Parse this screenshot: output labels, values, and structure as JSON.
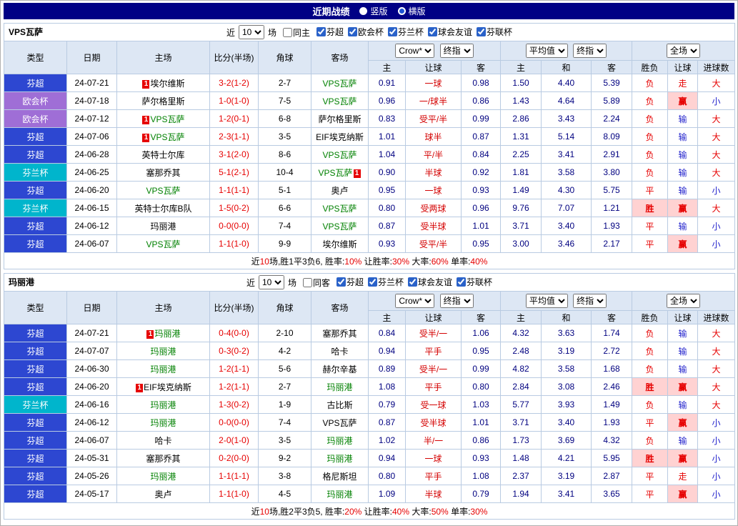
{
  "topbar": {
    "title": "近期战绩",
    "options": [
      {
        "label": "竖版",
        "selected": false
      },
      {
        "label": "横版",
        "selected": true
      }
    ]
  },
  "colors": {
    "topbar_bg": "#000085",
    "league_chao": "#2d47d1",
    "league_euro": "#9f6ed6",
    "league_cup": "#00b5cc",
    "score_red": "#e60000",
    "odds_navy": "#000080",
    "focus_team_green": "#008000",
    "lose_blue": "#2222cc",
    "win_bg": "#ffd2d2",
    "header_bg": "#dde7f4"
  },
  "columns": {
    "main": [
      "类型",
      "日期",
      "主场",
      "比分(半场)",
      "角球",
      "客场"
    ],
    "selects": [
      "Crow*",
      "终指",
      "平均值",
      "终指",
      "全场"
    ],
    "sub": [
      "主",
      "让球",
      "客",
      "主",
      "和",
      "客",
      "胜负",
      "让球",
      "进球数"
    ]
  },
  "sections": [
    {
      "team": "VPS瓦萨",
      "filter": {
        "near": "近",
        "count": "10",
        "games": "场",
        "same": "同主",
        "same_checked": false,
        "leagues": [
          {
            "label": "芬超",
            "checked": true
          },
          {
            "label": "欧会杯",
            "checked": true
          },
          {
            "label": "芬兰杯",
            "checked": true
          },
          {
            "label": "球会友谊",
            "checked": true
          },
          {
            "label": "芬联杯",
            "checked": true
          }
        ]
      },
      "rows": [
        {
          "lg": "芬超",
          "lgc": "blue",
          "date": "24-07-21",
          "home": {
            "n": "埃尔维斯",
            "g": false,
            "b": "1",
            "bs": "L"
          },
          "score": "3-2(1-2)",
          "corner": "2-7",
          "away": {
            "n": "VPS瓦萨",
            "g": true
          },
          "o": [
            "0.91",
            "一球",
            "0.98"
          ],
          "avg": [
            "1.50",
            "4.40",
            "5.39"
          ],
          "res": [
            {
              "t": "负",
              "s": "r"
            },
            {
              "t": "走",
              "s": "r"
            },
            {
              "t": "大",
              "s": "r"
            }
          ]
        },
        {
          "lg": "欧会杯",
          "lgc": "purple",
          "date": "24-07-18",
          "home": {
            "n": "萨尔格里斯",
            "g": false
          },
          "score": "1-0(1-0)",
          "corner": "7-5",
          "away": {
            "n": "VPS瓦萨",
            "g": true
          },
          "o": [
            "0.96",
            "一/球半",
            "0.86"
          ],
          "avg": [
            "1.43",
            "4.64",
            "5.89"
          ],
          "res": [
            {
              "t": "负",
              "s": "r"
            },
            {
              "t": "赢",
              "s": "w"
            },
            {
              "t": "小",
              "s": "b"
            }
          ]
        },
        {
          "lg": "欧会杯",
          "lgc": "purple",
          "date": "24-07-12",
          "home": {
            "n": "VPS瓦萨",
            "g": true,
            "b": "1",
            "bs": "L"
          },
          "score": "1-2(0-1)",
          "corner": "6-8",
          "away": {
            "n": "萨尔格里斯",
            "g": false
          },
          "o": [
            "0.83",
            "受平/半",
            "0.99"
          ],
          "avg": [
            "2.86",
            "3.43",
            "2.24"
          ],
          "res": [
            {
              "t": "负",
              "s": "r"
            },
            {
              "t": "输",
              "s": "b"
            },
            {
              "t": "大",
              "s": "r"
            }
          ]
        },
        {
          "lg": "芬超",
          "lgc": "blue",
          "date": "24-07-06",
          "home": {
            "n": "VPS瓦萨",
            "g": true,
            "b": "1",
            "bs": "L"
          },
          "score": "2-3(1-1)",
          "corner": "3-5",
          "away": {
            "n": "EIF埃克纳斯",
            "g": false
          },
          "o": [
            "1.01",
            "球半",
            "0.87"
          ],
          "avg": [
            "1.31",
            "5.14",
            "8.09"
          ],
          "res": [
            {
              "t": "负",
              "s": "r"
            },
            {
              "t": "输",
              "s": "b"
            },
            {
              "t": "大",
              "s": "r"
            }
          ]
        },
        {
          "lg": "芬超",
          "lgc": "blue",
          "date": "24-06-28",
          "home": {
            "n": "英特士尔库",
            "g": false
          },
          "score": "3-1(2-0)",
          "corner": "8-6",
          "away": {
            "n": "VPS瓦萨",
            "g": true
          },
          "o": [
            "1.04",
            "平/半",
            "0.84"
          ],
          "avg": [
            "2.25",
            "3.41",
            "2.91"
          ],
          "res": [
            {
              "t": "负",
              "s": "r"
            },
            {
              "t": "输",
              "s": "b"
            },
            {
              "t": "大",
              "s": "r"
            }
          ]
        },
        {
          "lg": "芬兰杯",
          "lgc": "cyan",
          "date": "24-06-25",
          "home": {
            "n": "塞那乔其",
            "g": false
          },
          "score": "5-1(2-1)",
          "corner": "10-4",
          "away": {
            "n": "VPS瓦萨",
            "g": true,
            "b": "1",
            "bs": "R"
          },
          "o": [
            "0.90",
            "半球",
            "0.92"
          ],
          "avg": [
            "1.81",
            "3.58",
            "3.80"
          ],
          "res": [
            {
              "t": "负",
              "s": "r"
            },
            {
              "t": "输",
              "s": "b"
            },
            {
              "t": "大",
              "s": "r"
            }
          ]
        },
        {
          "lg": "芬超",
          "lgc": "blue",
          "date": "24-06-20",
          "home": {
            "n": "VPS瓦萨",
            "g": true
          },
          "score": "1-1(1-1)",
          "corner": "5-1",
          "away": {
            "n": "奥卢",
            "g": false
          },
          "o": [
            "0.95",
            "一球",
            "0.93"
          ],
          "avg": [
            "1.49",
            "4.30",
            "5.75"
          ],
          "res": [
            {
              "t": "平",
              "s": "r"
            },
            {
              "t": "输",
              "s": "b"
            },
            {
              "t": "小",
              "s": "b"
            }
          ]
        },
        {
          "lg": "芬兰杯",
          "lgc": "cyan",
          "date": "24-06-15",
          "home": {
            "n": "英特士尔库B队",
            "g": false
          },
          "score": "1-5(0-2)",
          "corner": "6-6",
          "away": {
            "n": "VPS瓦萨",
            "g": true
          },
          "o": [
            "0.80",
            "受两球",
            "0.96"
          ],
          "avg": [
            "9.76",
            "7.07",
            "1.21"
          ],
          "res": [
            {
              "t": "胜",
              "s": "w"
            },
            {
              "t": "赢",
              "s": "w"
            },
            {
              "t": "大",
              "s": "r"
            }
          ]
        },
        {
          "lg": "芬超",
          "lgc": "blue",
          "date": "24-06-12",
          "home": {
            "n": "玛丽港",
            "g": false
          },
          "score": "0-0(0-0)",
          "corner": "7-4",
          "away": {
            "n": "VPS瓦萨",
            "g": true
          },
          "o": [
            "0.87",
            "受半球",
            "1.01"
          ],
          "avg": [
            "3.71",
            "3.40",
            "1.93"
          ],
          "res": [
            {
              "t": "平",
              "s": "r"
            },
            {
              "t": "输",
              "s": "b"
            },
            {
              "t": "小",
              "s": "b"
            }
          ]
        },
        {
          "lg": "芬超",
          "lgc": "blue",
          "date": "24-06-07",
          "home": {
            "n": "VPS瓦萨",
            "g": true
          },
          "score": "1-1(1-0)",
          "corner": "9-9",
          "away": {
            "n": "埃尔维斯",
            "g": false
          },
          "o": [
            "0.93",
            "受平/半",
            "0.95"
          ],
          "avg": [
            "3.00",
            "3.46",
            "2.17"
          ],
          "res": [
            {
              "t": "平",
              "s": "r"
            },
            {
              "t": "赢",
              "s": "w"
            },
            {
              "t": "小",
              "s": "b"
            }
          ]
        }
      ],
      "summary": [
        {
          "t": "近",
          "r": false
        },
        {
          "t": "10",
          "r": true
        },
        {
          "t": "场,胜1平3负6, 胜率:",
          "r": false
        },
        {
          "t": "10%",
          "r": true
        },
        {
          "t": " 让胜率:",
          "r": false
        },
        {
          "t": "30%",
          "r": true
        },
        {
          "t": " 大率:",
          "r": false
        },
        {
          "t": "60%",
          "r": true
        },
        {
          "t": " 单率:",
          "r": false
        },
        {
          "t": "40%",
          "r": true
        }
      ]
    },
    {
      "team": "玛丽港",
      "filter": {
        "near": "近",
        "count": "10",
        "games": "场",
        "same": "同客",
        "same_checked": false,
        "leagues": [
          {
            "label": "芬超",
            "checked": true
          },
          {
            "label": "芬兰杯",
            "checked": true
          },
          {
            "label": "球会友谊",
            "checked": true
          },
          {
            "label": "芬联杯",
            "checked": true
          }
        ]
      },
      "rows": [
        {
          "lg": "芬超",
          "lgc": "blue",
          "date": "24-07-21",
          "home": {
            "n": "玛丽港",
            "g": true,
            "b": "1",
            "bs": "L"
          },
          "score": "0-4(0-0)",
          "corner": "2-10",
          "away": {
            "n": "塞那乔其",
            "g": false
          },
          "o": [
            "0.84",
            "受半/一",
            "1.06"
          ],
          "avg": [
            "4.32",
            "3.63",
            "1.74"
          ],
          "res": [
            {
              "t": "负",
              "s": "r"
            },
            {
              "t": "输",
              "s": "b"
            },
            {
              "t": "大",
              "s": "r"
            }
          ]
        },
        {
          "lg": "芬超",
          "lgc": "blue",
          "date": "24-07-07",
          "home": {
            "n": "玛丽港",
            "g": true
          },
          "score": "0-3(0-2)",
          "corner": "4-2",
          "away": {
            "n": "哈卡",
            "g": false
          },
          "o": [
            "0.94",
            "平手",
            "0.95"
          ],
          "avg": [
            "2.48",
            "3.19",
            "2.72"
          ],
          "res": [
            {
              "t": "负",
              "s": "r"
            },
            {
              "t": "输",
              "s": "b"
            },
            {
              "t": "大",
              "s": "r"
            }
          ]
        },
        {
          "lg": "芬超",
          "lgc": "blue",
          "date": "24-06-30",
          "home": {
            "n": "玛丽港",
            "g": true
          },
          "score": "1-2(1-1)",
          "corner": "5-6",
          "away": {
            "n": "赫尔辛基",
            "g": false
          },
          "o": [
            "0.89",
            "受半/一",
            "0.99"
          ],
          "avg": [
            "4.82",
            "3.58",
            "1.68"
          ],
          "res": [
            {
              "t": "负",
              "s": "r"
            },
            {
              "t": "输",
              "s": "b"
            },
            {
              "t": "大",
              "s": "r"
            }
          ]
        },
        {
          "lg": "芬超",
          "lgc": "blue",
          "date": "24-06-20",
          "home": {
            "n": "EIF埃克纳斯",
            "g": false,
            "b": "1",
            "bs": "L"
          },
          "score": "1-2(1-1)",
          "corner": "2-7",
          "away": {
            "n": "玛丽港",
            "g": true
          },
          "o": [
            "1.08",
            "平手",
            "0.80"
          ],
          "avg": [
            "2.84",
            "3.08",
            "2.46"
          ],
          "res": [
            {
              "t": "胜",
              "s": "w"
            },
            {
              "t": "赢",
              "s": "w"
            },
            {
              "t": "大",
              "s": "r"
            }
          ]
        },
        {
          "lg": "芬兰杯",
          "lgc": "cyan",
          "date": "24-06-16",
          "home": {
            "n": "玛丽港",
            "g": true
          },
          "score": "1-3(0-2)",
          "corner": "1-9",
          "away": {
            "n": "古比斯",
            "g": false
          },
          "o": [
            "0.79",
            "受一球",
            "1.03"
          ],
          "avg": [
            "5.77",
            "3.93",
            "1.49"
          ],
          "res": [
            {
              "t": "负",
              "s": "r"
            },
            {
              "t": "输",
              "s": "b"
            },
            {
              "t": "大",
              "s": "r"
            }
          ]
        },
        {
          "lg": "芬超",
          "lgc": "blue",
          "date": "24-06-12",
          "home": {
            "n": "玛丽港",
            "g": true
          },
          "score": "0-0(0-0)",
          "corner": "7-4",
          "away": {
            "n": "VPS瓦萨",
            "g": false
          },
          "o": [
            "0.87",
            "受半球",
            "1.01"
          ],
          "avg": [
            "3.71",
            "3.40",
            "1.93"
          ],
          "res": [
            {
              "t": "平",
              "s": "r"
            },
            {
              "t": "赢",
              "s": "w"
            },
            {
              "t": "小",
              "s": "b"
            }
          ]
        },
        {
          "lg": "芬超",
          "lgc": "blue",
          "date": "24-06-07",
          "home": {
            "n": "哈卡",
            "g": false
          },
          "score": "2-0(1-0)",
          "corner": "3-5",
          "away": {
            "n": "玛丽港",
            "g": true
          },
          "o": [
            "1.02",
            "半/一",
            "0.86"
          ],
          "avg": [
            "1.73",
            "3.69",
            "4.32"
          ],
          "res": [
            {
              "t": "负",
              "s": "r"
            },
            {
              "t": "输",
              "s": "b"
            },
            {
              "t": "小",
              "s": "b"
            }
          ]
        },
        {
          "lg": "芬超",
          "lgc": "blue",
          "date": "24-05-31",
          "home": {
            "n": "塞那乔其",
            "g": false
          },
          "score": "0-2(0-0)",
          "corner": "9-2",
          "away": {
            "n": "玛丽港",
            "g": true
          },
          "o": [
            "0.94",
            "一球",
            "0.93"
          ],
          "avg": [
            "1.48",
            "4.21",
            "5.95"
          ],
          "res": [
            {
              "t": "胜",
              "s": "w"
            },
            {
              "t": "赢",
              "s": "w"
            },
            {
              "t": "小",
              "s": "b"
            }
          ]
        },
        {
          "lg": "芬超",
          "lgc": "blue",
          "date": "24-05-26",
          "home": {
            "n": "玛丽港",
            "g": true
          },
          "score": "1-1(1-1)",
          "corner": "3-8",
          "away": {
            "n": "格尼斯坦",
            "g": false
          },
          "o": [
            "0.80",
            "平手",
            "1.08"
          ],
          "avg": [
            "2.37",
            "3.19",
            "2.87"
          ],
          "res": [
            {
              "t": "平",
              "s": "r"
            },
            {
              "t": "走",
              "s": "r"
            },
            {
              "t": "小",
              "s": "b"
            }
          ]
        },
        {
          "lg": "芬超",
          "lgc": "blue",
          "date": "24-05-17",
          "home": {
            "n": "奥卢",
            "g": false
          },
          "score": "1-1(1-0)",
          "corner": "4-5",
          "away": {
            "n": "玛丽港",
            "g": true
          },
          "o": [
            "1.09",
            "半球",
            "0.79"
          ],
          "avg": [
            "1.94",
            "3.41",
            "3.65"
          ],
          "res": [
            {
              "t": "平",
              "s": "r"
            },
            {
              "t": "赢",
              "s": "w"
            },
            {
              "t": "小",
              "s": "b"
            }
          ]
        }
      ],
      "summary": [
        {
          "t": "近",
          "r": false
        },
        {
          "t": "10",
          "r": true
        },
        {
          "t": "场,胜2平3负5, 胜率:",
          "r": false
        },
        {
          "t": "20%",
          "r": true
        },
        {
          "t": " 让胜率:",
          "r": false
        },
        {
          "t": "40%",
          "r": true
        },
        {
          "t": " 大率:",
          "r": false
        },
        {
          "t": "50%",
          "r": true
        },
        {
          "t": " 单率:",
          "r": false
        },
        {
          "t": "30%",
          "r": true
        }
      ]
    }
  ]
}
